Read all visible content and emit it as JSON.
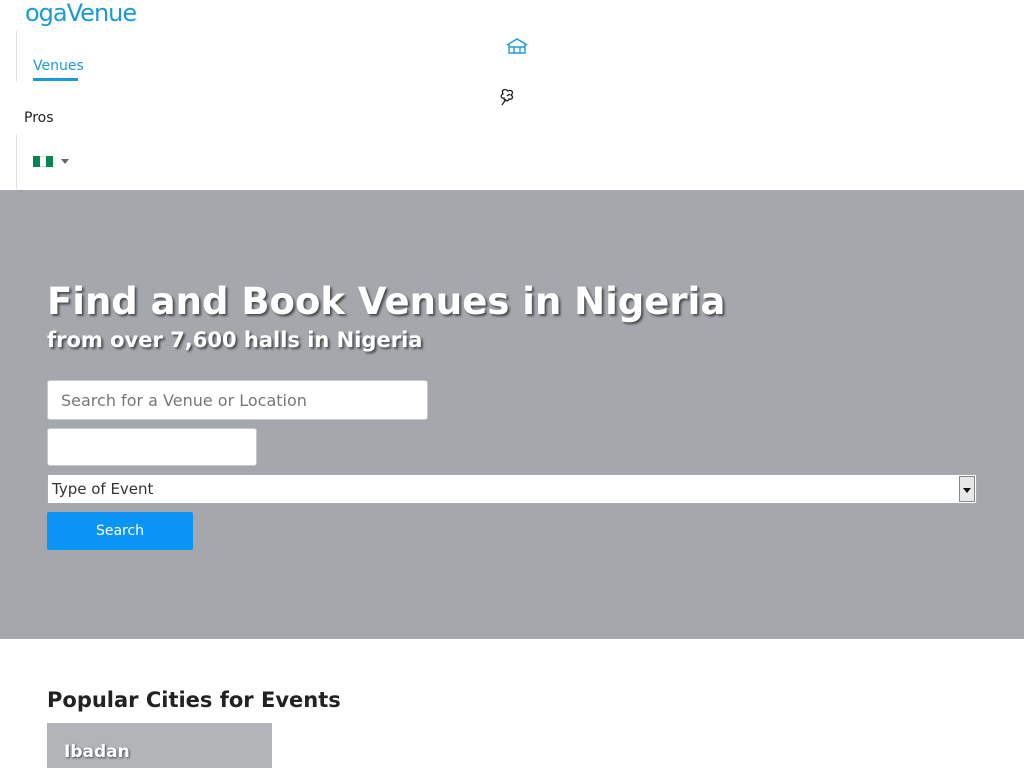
{
  "header": {
    "logo_text": "ogaVenue",
    "nav": {
      "venues_label": "Venues",
      "pros_label": "Pros"
    },
    "country": {
      "flag_icon": "nigeria-flag-icon",
      "flag_colors": [
        "#008751",
        "#ffffff",
        "#008751"
      ]
    }
  },
  "hero": {
    "title": "Find and Book Venues in Nigeria",
    "subtitle": "from over 7,600 halls in Nigeria",
    "search_placeholder": "Search for a Venue or Location",
    "event_type_selected": "Type of Event",
    "search_button_label": "Search",
    "background_color": "#a4a8ad"
  },
  "popular": {
    "title": "Popular Cities for Events",
    "cities": [
      {
        "name": "Ibadan"
      }
    ]
  },
  "colors": {
    "brand": "#1a9bd7",
    "button": "#0a94f5"
  }
}
